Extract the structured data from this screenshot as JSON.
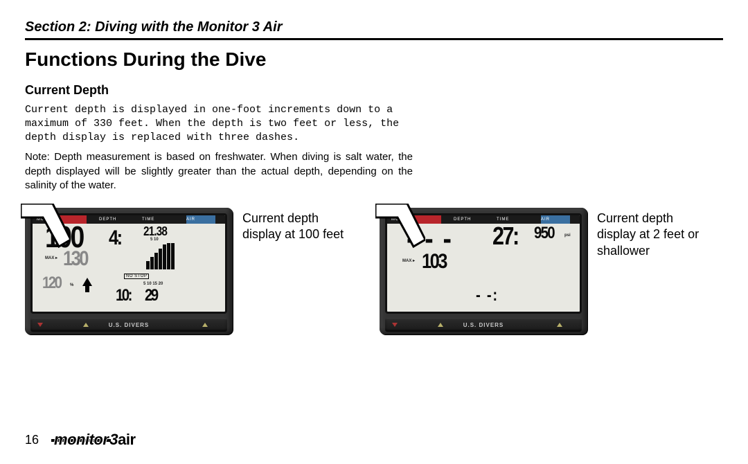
{
  "section_title": "Section 2: Diving with the Monitor 3 Air",
  "heading": "Functions During the Dive",
  "subheading": "Current Depth",
  "para_mono": "Current depth is displayed in one-foot increments down to a maximum of 330 feet. When the depth is two feet or less, the depth display is replaced with three dashes.",
  "para_note": "Note: Depth measurement is based on freshwater. When diving is salt water, the depth displayed will be slightly greater than the actual depth, depending on the salinity of the water.",
  "fig1": {
    "caption": "Current depth display at 100 feet",
    "header": {
      "mc": "MC",
      "depth": "DEPTH",
      "time": "TIME",
      "air": "AIR"
    },
    "depth_value": "100",
    "max_label": "MAX ▸",
    "max_value": "130",
    "pct_value": "120",
    "pct_label": "%",
    "hours": "4",
    "tiny_top": "21.38",
    "bars_top": "5   10",
    "no_stop": "NO STOP",
    "bars_bottom": "5  10    15   20",
    "bottom_l": "10",
    "bottom_r": "29",
    "brand_foot": "U.S. DIVERS"
  },
  "fig2": {
    "caption": "Current depth display at 2 feet or shallower",
    "header": {
      "mc": "MC",
      "depth": "DEPTH",
      "time": "TIME",
      "air": "AIR"
    },
    "depth_value": "- - -",
    "max_label": "MAX ▸",
    "max_value": "103",
    "time_value": "27",
    "air_value": "950",
    "air_unit": "psi",
    "bottom_dash": "- -",
    "brand_foot": "U.S. DIVERS"
  },
  "footer": {
    "page": "16",
    "brand_mon": "monitor",
    "brand_three": "3",
    "brand_air": "air"
  }
}
